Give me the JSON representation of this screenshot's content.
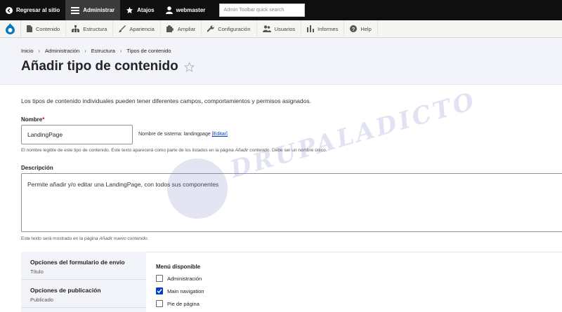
{
  "toolbar": {
    "back_label": "Regresar al sitio",
    "admin_label": "Administrar",
    "shortcuts_label": "Atajos",
    "user_label": "webmaster",
    "search_placeholder": "Admin Toolbar quick search"
  },
  "tray": {
    "items": [
      {
        "label": "Contenido",
        "icon": "page-icon"
      },
      {
        "label": "Estructura",
        "icon": "structure-icon"
      },
      {
        "label": "Apariencia",
        "icon": "brush-icon"
      },
      {
        "label": "Ampliar",
        "icon": "puzzle-icon"
      },
      {
        "label": "Configuración",
        "icon": "wrench-icon"
      },
      {
        "label": "Usuarios",
        "icon": "users-icon"
      },
      {
        "label": "Informes",
        "icon": "bars-icon"
      },
      {
        "label": "Help",
        "icon": "help-icon"
      }
    ]
  },
  "breadcrumb": [
    "Inicio",
    "Administración",
    "Estructura",
    "Tipos de contenido"
  ],
  "page_title": "Añadir tipo de contenido",
  "intro": "Los tipos de contenido individuales pueden tener diferentes campos, comportamientos y permisos asignados.",
  "name_field": {
    "label": "Nombre",
    "required_mark": "*",
    "value": "LandingPage",
    "machine_prefix": "Nombre de sistema: landingpage",
    "edit_link": "[Editar]",
    "help_before": "El nombre legible de este tipo de contenido. Este texto aparecerá como parte de los listados en la página ",
    "help_em": "Añadir contenido",
    "help_after": ". Debe ser un nombre único."
  },
  "description_field": {
    "label": "Descripción",
    "value": "Permite añadir y/o editar una LandingPage, con todos sus componentes",
    "help_before": "Este texto será mostrado en la página ",
    "help_em": "Añadir nuevo contenido",
    "help_after": "."
  },
  "vertical_tabs": [
    {
      "title": "Opciones del formulario de envío",
      "summary": "Título"
    },
    {
      "title": "Opciones de publicación",
      "summary": "Publicado"
    }
  ],
  "menu_pane": {
    "title": "Menú disponible",
    "options": [
      {
        "label": "Administración",
        "checked": false
      },
      {
        "label": "Main navigation",
        "checked": true
      },
      {
        "label": "Pie de página",
        "checked": false
      }
    ]
  },
  "watermark": "DRUPALADICTO",
  "colors": {
    "toolbar_bg": "#0f0f0f",
    "accent": "#003ecc",
    "required": "#cc0000"
  }
}
